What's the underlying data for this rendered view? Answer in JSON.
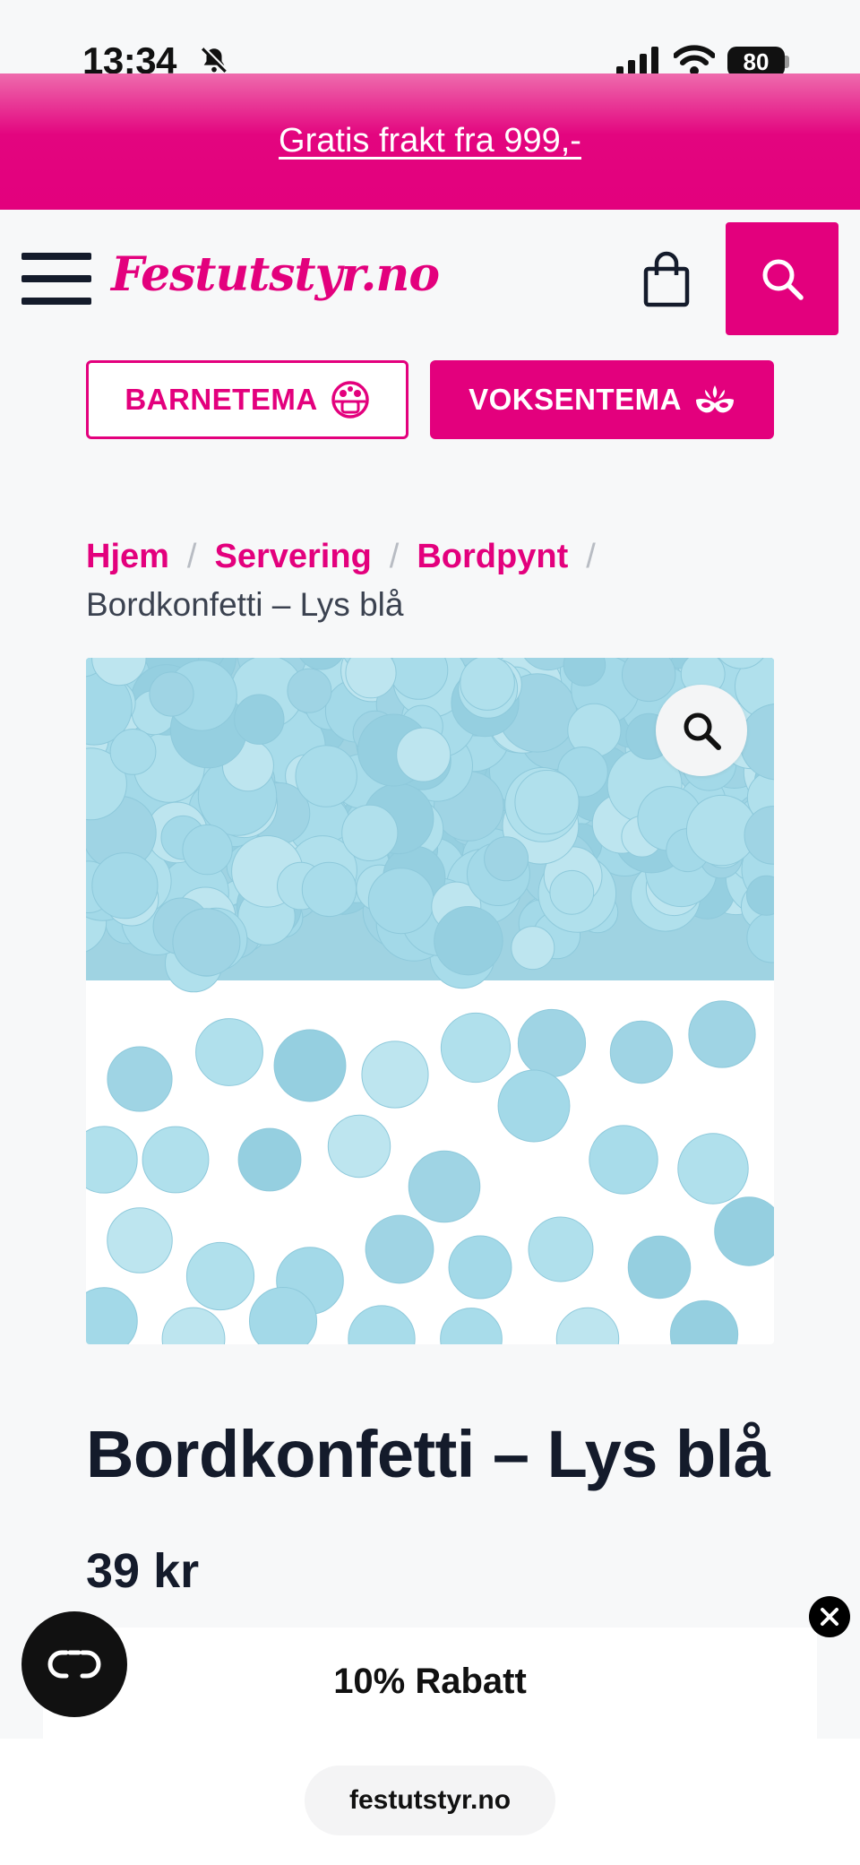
{
  "status_bar": {
    "time": "13:34",
    "battery": "80"
  },
  "promo_banner": {
    "text": "Gratis frakt fra 999,-"
  },
  "header": {
    "logo": "Festutstyr.no"
  },
  "theme_buttons": {
    "kids": "BARNETEMA",
    "adults": "VOKSENTEMA"
  },
  "breadcrumb": {
    "links": [
      "Hjem",
      "Servering",
      "Bordpynt"
    ],
    "separator": "/",
    "current": "Bordkonfetti – Lys blå"
  },
  "product": {
    "title": "Bordkonfetti – Lys blå",
    "price": "39 kr"
  },
  "discount_popup": {
    "text": "10% Rabatt"
  },
  "browser": {
    "url": "festutstyr.no"
  },
  "colors": {
    "brand": "#e3007d",
    "text": "#141b2b",
    "confetti": "#a8dcea"
  }
}
